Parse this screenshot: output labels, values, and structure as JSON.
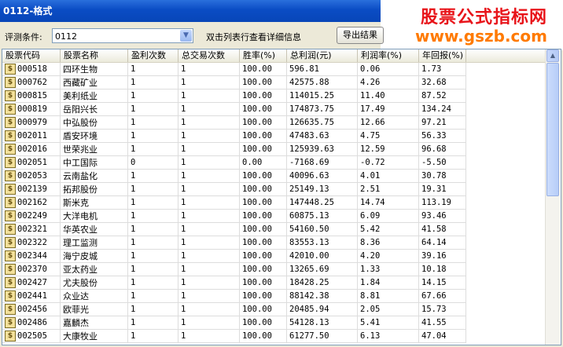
{
  "window": {
    "title": "0112-格式"
  },
  "watermark": {
    "line1": "股票公式指标网",
    "line2": "www.gszb.com"
  },
  "toolbar": {
    "condition_label": "评测条件:",
    "condition_value": "0112",
    "hint": "双击列表行查看详细信息",
    "export_label": "导出结果"
  },
  "table": {
    "headers": [
      "股票代码",
      "股票名称",
      "盈利次数",
      "总交易次数",
      "胜率(%)",
      "总利润(元)",
      "利润率(%)",
      "年回报(%)"
    ],
    "rows": [
      [
        "000518",
        "四环生物",
        "1",
        "1",
        "100.00",
        "596.81",
        "0.06",
        "1.73"
      ],
      [
        "000762",
        "西藏矿业",
        "1",
        "1",
        "100.00",
        "42575.88",
        "4.26",
        "32.68"
      ],
      [
        "000815",
        "美利纸业",
        "1",
        "1",
        "100.00",
        "114015.25",
        "11.40",
        "87.52"
      ],
      [
        "000819",
        "岳阳兴长",
        "1",
        "1",
        "100.00",
        "174873.75",
        "17.49",
        "134.24"
      ],
      [
        "000979",
        "中弘股份",
        "1",
        "1",
        "100.00",
        "126635.75",
        "12.66",
        "97.21"
      ],
      [
        "002011",
        "盾安环境",
        "1",
        "1",
        "100.00",
        "47483.63",
        "4.75",
        "56.33"
      ],
      [
        "002016",
        "世荣兆业",
        "1",
        "1",
        "100.00",
        "125939.63",
        "12.59",
        "96.68"
      ],
      [
        "002051",
        "中工国际",
        "0",
        "1",
        "0.00",
        "-7168.69",
        "-0.72",
        "-5.50"
      ],
      [
        "002053",
        "云南盐化",
        "1",
        "1",
        "100.00",
        "40096.63",
        "4.01",
        "30.78"
      ],
      [
        "002139",
        "拓邦股份",
        "1",
        "1",
        "100.00",
        "25149.13",
        "2.51",
        "19.31"
      ],
      [
        "002162",
        "斯米克",
        "1",
        "1",
        "100.00",
        "147448.25",
        "14.74",
        "113.19"
      ],
      [
        "002249",
        "大洋电机",
        "1",
        "1",
        "100.00",
        "60875.13",
        "6.09",
        "93.46"
      ],
      [
        "002321",
        "华英农业",
        "1",
        "1",
        "100.00",
        "54160.50",
        "5.42",
        "41.58"
      ],
      [
        "002322",
        "理工监测",
        "1",
        "1",
        "100.00",
        "83553.13",
        "8.36",
        "64.14"
      ],
      [
        "002344",
        "海宁皮城",
        "1",
        "1",
        "100.00",
        "42010.00",
        "4.20",
        "39.16"
      ],
      [
        "002370",
        "亚太药业",
        "1",
        "1",
        "100.00",
        "13265.69",
        "1.33",
        "10.18"
      ],
      [
        "002427",
        "尤夫股份",
        "1",
        "1",
        "100.00",
        "18428.25",
        "1.84",
        "14.15"
      ],
      [
        "002441",
        "众业达",
        "1",
        "1",
        "100.00",
        "88142.38",
        "8.81",
        "67.66"
      ],
      [
        "002456",
        "欧菲光",
        "1",
        "1",
        "100.00",
        "20485.94",
        "2.05",
        "15.73"
      ],
      [
        "002486",
        "嘉麟杰",
        "1",
        "1",
        "100.00",
        "54128.13",
        "5.41",
        "41.55"
      ],
      [
        "002505",
        "大康牧业",
        "1",
        "1",
        "100.00",
        "61277.50",
        "6.13",
        "47.04"
      ]
    ]
  },
  "icons": {
    "row_icon": "dollar-icon",
    "dropdown": "chevron-down-icon"
  },
  "colors": {
    "title_bar": "#0a4cc4",
    "watermark_red": "#e8141a",
    "watermark_orange": "#ff7a00"
  }
}
